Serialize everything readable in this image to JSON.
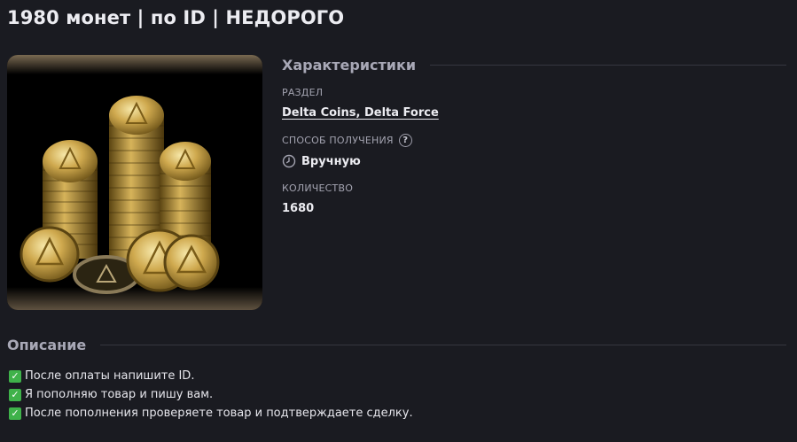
{
  "product": {
    "title": "1980 монет | по ID | НЕДОРОГО",
    "image_icon": "coins-pile-image"
  },
  "specs": {
    "heading": "Характеристики",
    "section": {
      "label": "РАЗДЕЛ",
      "value": "Delta Coins, Delta Force"
    },
    "method": {
      "label": "СПОСОБ ПОЛУЧЕНИЯ",
      "help_icon": "question-circle-icon",
      "value_icon": "clock-icon",
      "value": "Вручную"
    },
    "quantity": {
      "label": "КОЛИЧЕСТВО",
      "value": "1680"
    }
  },
  "description": {
    "heading": "Описание",
    "check_icon": "check-mark-icon",
    "lines": [
      "После оплаты напишите ID.",
      "Я пополняю товар и пишу вам.",
      "После пополнения проверяете товар и подтверждаете сделку."
    ]
  },
  "colors": {
    "background": "#1a1b21",
    "divider": "#36373f",
    "check_green": "#3fb24a",
    "coin_gold": "#d4b15a"
  }
}
